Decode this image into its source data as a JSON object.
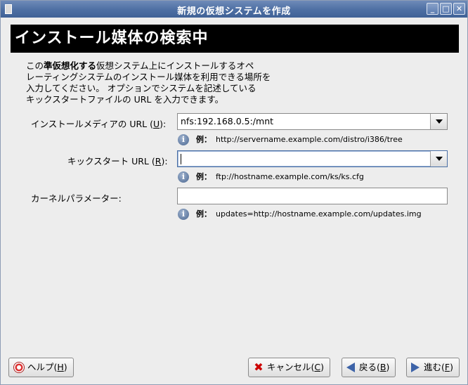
{
  "window": {
    "title": "新規の仮想システムを作成",
    "minimize": "_",
    "maximize": "□",
    "close": "✕"
  },
  "header": {
    "banner": "インストール媒体の検索中"
  },
  "intro": {
    "prefix": "この",
    "bold": "準仮想化する",
    "line1_rest": "仮想システム上にインストールするオペ",
    "line2": "レーティングシステムのインストール媒体を利用できる場所を",
    "line3": "入力してください。 オプションでシステムを記述している",
    "line4": "キックスタートファイルの URL を入力できます。"
  },
  "form": {
    "media_url": {
      "label_pre": "インストールメディアの URL (",
      "label_key": "U",
      "label_post": "):",
      "value": "nfs:192.168.0.5:/mnt",
      "hint_prefix": "例：",
      "hint": "http://servername.example.com/distro/i386/tree"
    },
    "kickstart_url": {
      "label_pre": "キックスタート URL (",
      "label_key": "R",
      "label_post": "):",
      "value": "",
      "hint_prefix": "例：",
      "hint": "ftp://hostname.example.com/ks/ks.cfg"
    },
    "kernel_params": {
      "label": "カーネルパラメーター:",
      "value": "",
      "hint_prefix": "例：",
      "hint": "updates=http://hostname.example.com/updates.img"
    }
  },
  "buttons": {
    "help": {
      "label_pre": "ヘルプ(",
      "key": "H",
      "label_post": ")"
    },
    "cancel": {
      "label_pre": "キャンセル(",
      "key": "C",
      "label_post": ")"
    },
    "back": {
      "label_pre": "戻る(",
      "key": "B",
      "label_post": ")"
    },
    "forward": {
      "label_pre": "進む(",
      "key": "F",
      "label_post": ")"
    }
  }
}
